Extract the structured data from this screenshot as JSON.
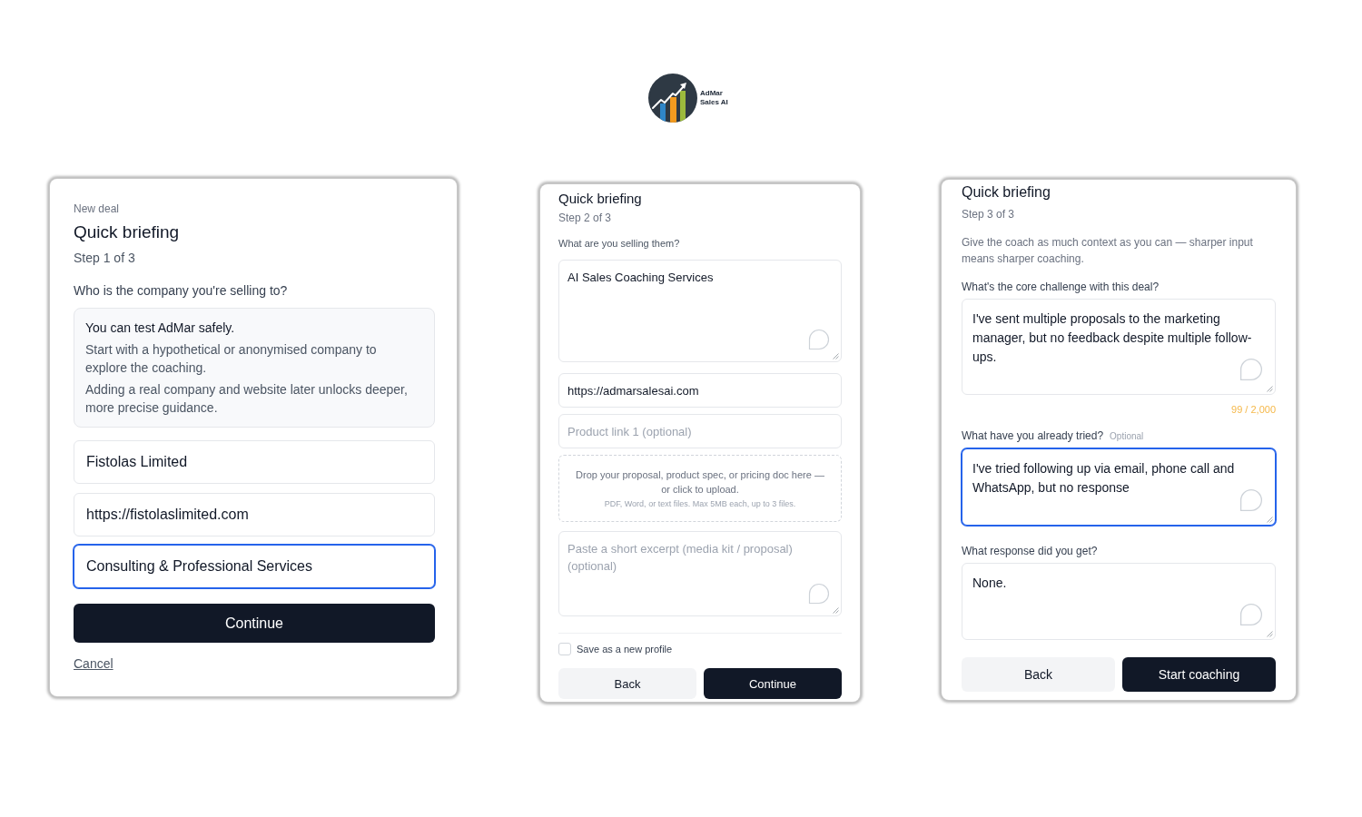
{
  "logo": {
    "name": "AdMar",
    "subtitle": "Sales AI"
  },
  "panels": [
    {
      "eyebrow": "New deal",
      "title": "Quick briefing",
      "step": "Step 1 of 3",
      "items": [
        {
          "kind": "question",
          "text": "Who is the company you're selling to?"
        },
        {
          "kind": "notice",
          "heading": "You can test AdMar safely.",
          "paragraphs": [
            "Start with a hypothetical or anonymised company to explore the coaching.",
            "Adding a real company and website later unlocks deeper, more precise guidance."
          ]
        },
        {
          "kind": "input",
          "value": "Fistolas Limited",
          "focused": false
        },
        {
          "kind": "input",
          "value": "https://fistolaslimited.com",
          "focused": false
        },
        {
          "kind": "input",
          "value": "Consulting & Professional Services",
          "focused": true
        }
      ],
      "buttons": [
        {
          "label": "Continue",
          "kind": "primary"
        }
      ],
      "link": "Cancel"
    },
    {
      "title": "Quick briefing",
      "step": "Step 2 of 3",
      "items": [
        {
          "kind": "question",
          "text": "What are you selling them?"
        },
        {
          "kind": "textarea",
          "value": "AI Sales Coaching Services",
          "focused": false
        },
        {
          "kind": "input",
          "value": "https://admarsalesai.com",
          "focused": false
        },
        {
          "kind": "input",
          "placeholder": "Product link 1 (optional)",
          "focused": false
        },
        {
          "kind": "dropzone",
          "text": "Drop your proposal, product spec, or pricing doc here — or click to upload.",
          "hint": "PDF, Word, or text files. Max 5MB each, up to 3 files."
        },
        {
          "kind": "textarea",
          "placeholder": "Paste a short excerpt (media kit / proposal) (optional)",
          "focused": false
        },
        {
          "kind": "checkbox",
          "label": "Save as a new profile",
          "checked": false
        }
      ],
      "buttons": [
        {
          "label": "Back",
          "kind": "secondary"
        },
        {
          "label": "Continue",
          "kind": "primary"
        }
      ]
    },
    {
      "title": "Quick briefing",
      "step": "Step 3 of 3",
      "items": [
        {
          "kind": "intro",
          "text": "Give the coach as much context as you can — sharper input means sharper coaching."
        },
        {
          "kind": "question",
          "text": "What's the core challenge with this deal?"
        },
        {
          "kind": "textarea",
          "value": "I've sent multiple proposals to the marketing manager, but no feedback despite multiple follow-ups.",
          "focused": false
        },
        {
          "kind": "counter",
          "text": "99 / 2,000"
        },
        {
          "kind": "question",
          "text": "What have you already tried?",
          "tag": "Optional"
        },
        {
          "kind": "textarea",
          "value": "I've tried following up via email, phone call and WhatsApp, but no response",
          "focused": true
        },
        {
          "kind": "question",
          "text": "What response did you get?"
        },
        {
          "kind": "textarea",
          "value": "None.",
          "focused": false
        }
      ],
      "buttons": [
        {
          "label": "Back",
          "kind": "secondary"
        },
        {
          "label": "Start coaching",
          "kind": "primary"
        }
      ]
    }
  ]
}
